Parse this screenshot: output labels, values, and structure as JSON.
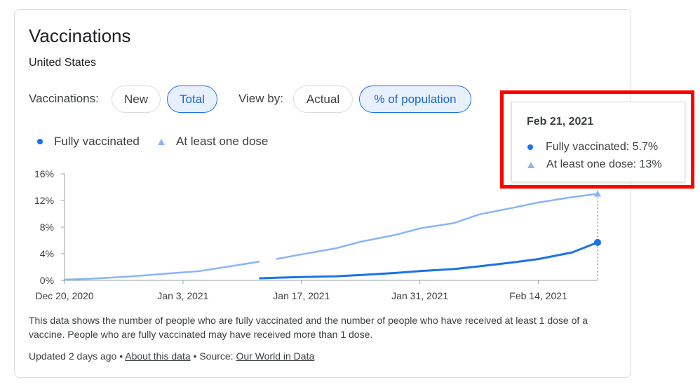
{
  "card": {
    "title": "Vaccinations",
    "subtitle": "United States"
  },
  "controls": {
    "vaccinations_label": "Vaccinations:",
    "new_label": "New",
    "total_label": "Total",
    "viewby_label": "View by:",
    "actual_label": "Actual",
    "percent_label": "% of population",
    "selected": [
      "Total",
      "% of population"
    ]
  },
  "legend": {
    "fully": "Fully vaccinated",
    "one_dose": "At least one dose"
  },
  "colors": {
    "fully": "#1a73e8",
    "one_dose": "#8ab4f8",
    "highlight": "#ff0000"
  },
  "chart_data": {
    "type": "line",
    "x_start": "2020-12-20",
    "x_end": "2021-02-21",
    "ylim": [
      0,
      16
    ],
    "y_ticks": [
      "0%",
      "4%",
      "8%",
      "12%",
      "16%"
    ],
    "x_ticks": [
      "Dec 20, 2020",
      "Jan 3, 2021",
      "Jan 17, 2021",
      "Jan 31, 2021",
      "Feb 14, 2021"
    ],
    "grid": false,
    "series": [
      {
        "name": "Fully vaccinated",
        "x": [
          "2021-01-12",
          "2021-01-14",
          "2021-01-17",
          "2021-01-21",
          "2021-01-24",
          "2021-01-28",
          "2021-01-31",
          "2021-02-04",
          "2021-02-07",
          "2021-02-11",
          "2021-02-14",
          "2021-02-18",
          "2021-02-21"
        ],
        "values": [
          0.3,
          0.4,
          0.5,
          0.6,
          0.8,
          1.1,
          1.4,
          1.7,
          2.1,
          2.7,
          3.2,
          4.2,
          5.7
        ]
      },
      {
        "name": "At least one dose",
        "x": [
          "2020-12-20",
          "2020-12-24",
          "2020-12-28",
          "2021-01-01",
          "2021-01-05",
          "2021-01-09",
          "2021-01-12",
          "2021-01-14",
          "2021-01-17",
          "2021-01-21",
          "2021-01-24",
          "2021-01-28",
          "2021-01-31",
          "2021-02-04",
          "2021-02-07",
          "2021-02-11",
          "2021-02-14",
          "2021-02-18",
          "2021-02-21"
        ],
        "values": [
          0.1,
          0.3,
          0.6,
          1.0,
          1.4,
          2.2,
          2.8,
          3.2,
          3.9,
          4.8,
          5.8,
          6.8,
          7.8,
          8.6,
          9.9,
          10.9,
          11.7,
          12.5,
          13.0
        ]
      }
    ]
  },
  "tooltip": {
    "date": "Feb 21, 2021",
    "fully": "Fully vaccinated: 5.7%",
    "one_dose": "At least one dose: 13%"
  },
  "description": "This data shows the number of people who are fully vaccinated and the number of people who have received at least 1 dose of a vaccine. People who are fully vaccinated may have received more than 1 dose.",
  "footer": {
    "updated": "Updated 2 days ago • ",
    "about_link": "About this data",
    "source_prefix": " • Source: ",
    "source_link": "Our World in Data"
  }
}
